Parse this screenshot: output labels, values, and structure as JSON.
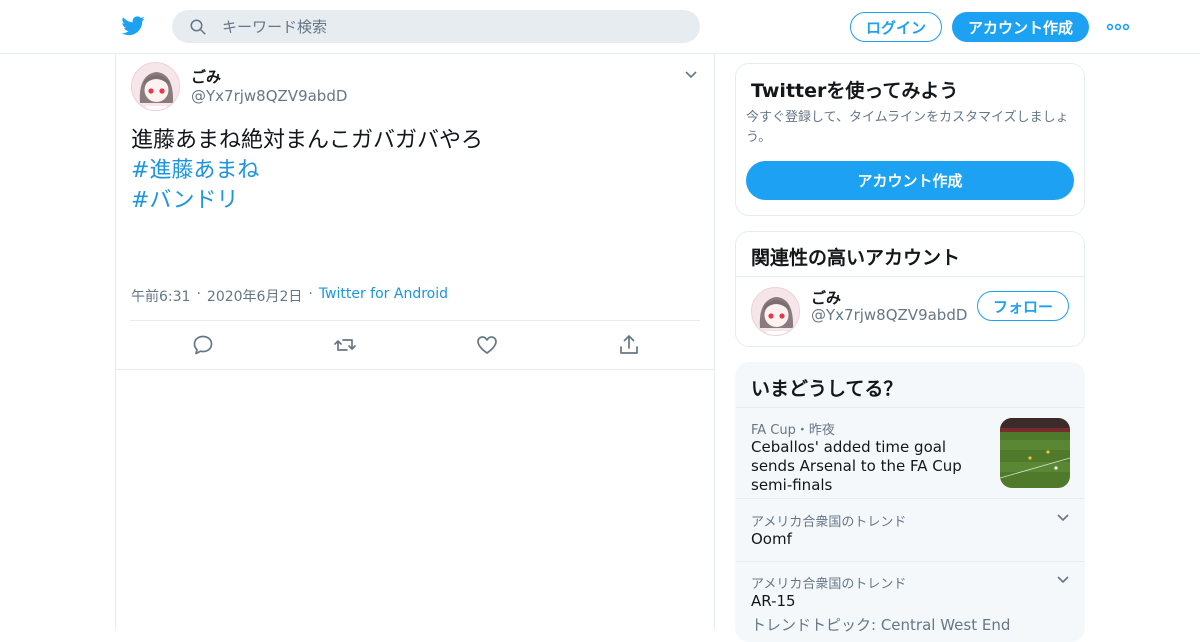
{
  "header": {
    "search_placeholder": "キーワード検索",
    "login_label": "ログイン",
    "signup_label": "アカウント作成",
    "brand_color": "#1da1f2"
  },
  "tweet": {
    "user_name": "ごみ",
    "user_handle": "@Yx7rjw8QZV9abdD",
    "text": "進藤あまね絶対まんこガバガバやろ",
    "hashtags": [
      "#進藤あまね",
      "#バンドリ"
    ],
    "time": "午前6:31",
    "date": "2020年6月2日",
    "source": "Twitter for Android"
  },
  "sidebar": {
    "signup_card": {
      "title": "Twitterを使ってみよう",
      "subtitle": "今すぐ登録して、タイムラインをカスタマイズしましょう。",
      "button": "アカウント作成"
    },
    "related_card": {
      "title": "関連性の高いアカウント",
      "user_name": "ごみ",
      "user_handle": "@Yx7rjw8QZV9abdD",
      "follow_label": "フォロー"
    },
    "trends_card": {
      "title": "いまどうしてる？",
      "items": [
        {
          "meta": "FA Cup・昨夜",
          "title": "Ceballos' added time goal sends Arsenal to the FA Cup semi-finals"
        },
        {
          "meta": "アメリカ合衆国のトレンド",
          "title": "Oomf"
        },
        {
          "meta": "アメリカ合衆国のトレンド",
          "title": "AR-15",
          "extra": "トレンドトピック: Central West End"
        }
      ]
    }
  },
  "icons": [
    "twitter-bird-icon",
    "search-icon",
    "more-icon",
    "caret-down-icon",
    "reply-icon",
    "retweet-icon",
    "like-icon",
    "share-icon"
  ]
}
